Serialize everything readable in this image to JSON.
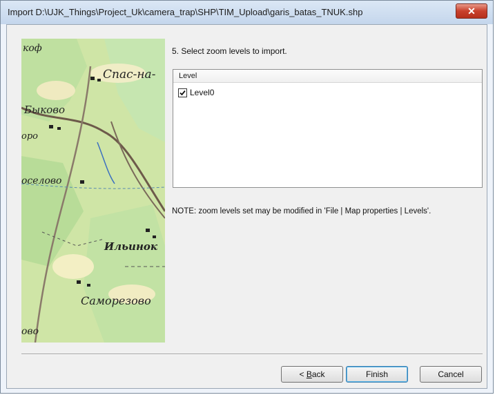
{
  "window": {
    "title": "Import D:\\UJK_Things\\Project_Uk\\camera_trap\\SHP\\TIM_Upload\\garis_batas_TNUK.shp",
    "close_label": "✕"
  },
  "step": {
    "label": "5. Select zoom levels to import."
  },
  "levels": {
    "header": "Level",
    "items": [
      {
        "label": "Level0",
        "checked": true
      }
    ]
  },
  "note": "NOTE: zoom levels set may be modified in 'File | Map properties | Levels'.",
  "map": {
    "labels": [
      "Спас-на-",
      "Быково",
      "Ильинок",
      "Саморезово"
    ],
    "fragments": [
      "коф",
      "оро",
      "оселово",
      "ово"
    ]
  },
  "buttons": {
    "back_prefix": "< ",
    "back_accel": "B",
    "back_rest": "ack",
    "finish": "Finish",
    "cancel": "Cancel"
  }
}
